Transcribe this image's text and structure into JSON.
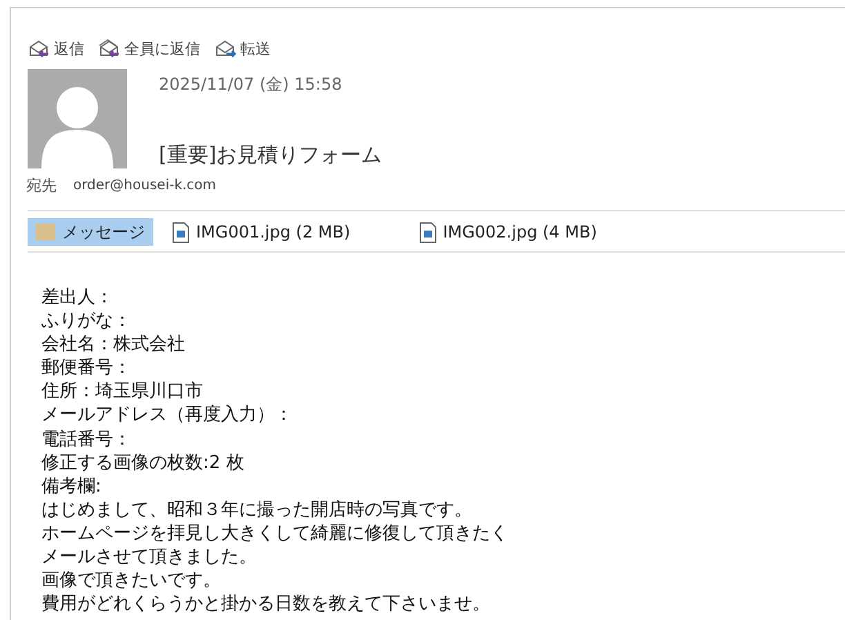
{
  "actions": [
    {
      "kind": "reply",
      "label": "返信"
    },
    {
      "kind": "reply_all",
      "label": "全員に返信"
    },
    {
      "kind": "forward",
      "label": "転送"
    }
  ],
  "header": {
    "date": "2025/11/07 (金) 15:58",
    "subject": "[重要]お見積りフォーム",
    "to_label": "宛先",
    "to": "order@housei-k.com"
  },
  "attachments": [
    {
      "kind": "message",
      "label": "メッセージ",
      "selected": true
    },
    {
      "kind": "image",
      "label": "IMG001.jpg (2 MB)",
      "selected": false
    },
    {
      "kind": "image",
      "label": "IMG002.jpg (4 MB)",
      "selected": false
    }
  ],
  "body": [
    "差出人：",
    "ふりがな：",
    "会社名：株式会社",
    "郵便番号：",
    "住所：埼玉県川口市",
    "メールアドレス（再度入力）：",
    "電話番号：",
    "修正する画像の枚数:2 枚",
    "備考欄:",
    "はじめまして、昭和３年に撮った開店時の写真です。",
    "ホームページを拝見し大きくして綺麗に修復して頂きたく",
    "メールさせて頂きました。",
    "画像で頂きたいです。",
    "費用がどれくらうかと掛かる日数を教えて下さいませ。"
  ]
}
